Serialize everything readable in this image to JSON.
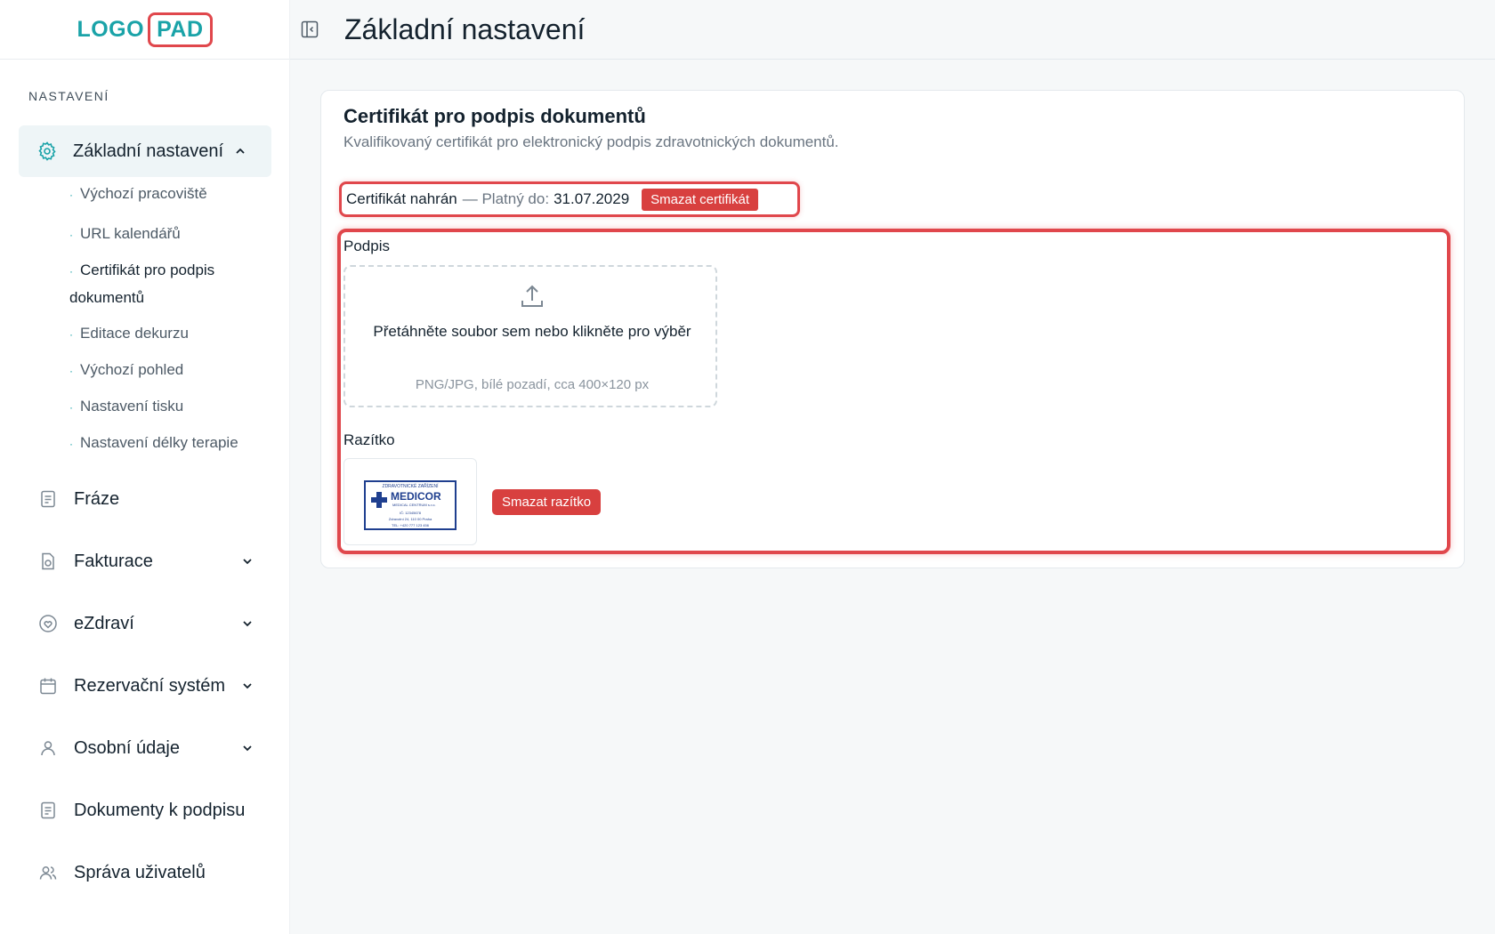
{
  "logo": {
    "left": "LOGO",
    "right": "PAD"
  },
  "sidebar": {
    "section_label": "NASTAVENÍ",
    "active_item": "Základní nastavení",
    "sub_items": [
      "Výchozí pracoviště",
      "URL kalendářů",
      "Certifikát pro podpis dokumentů",
      "Editace dekurzu",
      "Výchozí pohled",
      "Nastavení tisku",
      "Nastavení délky terapie"
    ],
    "items": [
      {
        "label": "Fráze",
        "icon": "document-icon"
      },
      {
        "label": "Fakturace",
        "icon": "invoice-icon"
      },
      {
        "label": "eZdraví",
        "icon": "heart-icon"
      },
      {
        "label": "Rezervační systém",
        "icon": "calendar-icon"
      },
      {
        "label": "Osobní údaje",
        "icon": "user-icon"
      },
      {
        "label": "Dokumenty k podpisu",
        "icon": "document-icon"
      },
      {
        "label": "Správa uživatelů",
        "icon": "users-icon"
      }
    ]
  },
  "header": {
    "title": "Základní nastavení"
  },
  "card": {
    "title": "Certifikát pro podpis dokumentů",
    "description": "Kvalifikovaný certifikát pro elektronický podpis zdravotnických dokumentů.",
    "cert_status": "Certifikát nahrán",
    "cert_valid_label": "— Platný do:",
    "cert_valid_date": "31.07.2029",
    "cert_delete": "Smazat certifikát",
    "signature_label": "Podpis",
    "dropzone_text": "Přetáhněte soubor sem nebo klikněte pro výběr",
    "dropzone_hint": "PNG/JPG, bílé pozadí, cca 400×120 px",
    "stamp_label": "Razítko",
    "stamp_delete": "Smazat razítko",
    "stamp_image": {
      "top": "ZDRAVOTNICKÉ ZAŘÍZENÍ",
      "name": "MEDICOR",
      "sub": "MEDICAL CENTRUM s.r.o.",
      "line1": "IČ: 12345678",
      "line2": "Zdravotní 24, 110 00 Praha",
      "line3": "TEL: +420 777 123 456"
    }
  },
  "colors": {
    "accent": "#1aa3a8",
    "danger": "#d8403f",
    "highlight": "#e0474c"
  }
}
